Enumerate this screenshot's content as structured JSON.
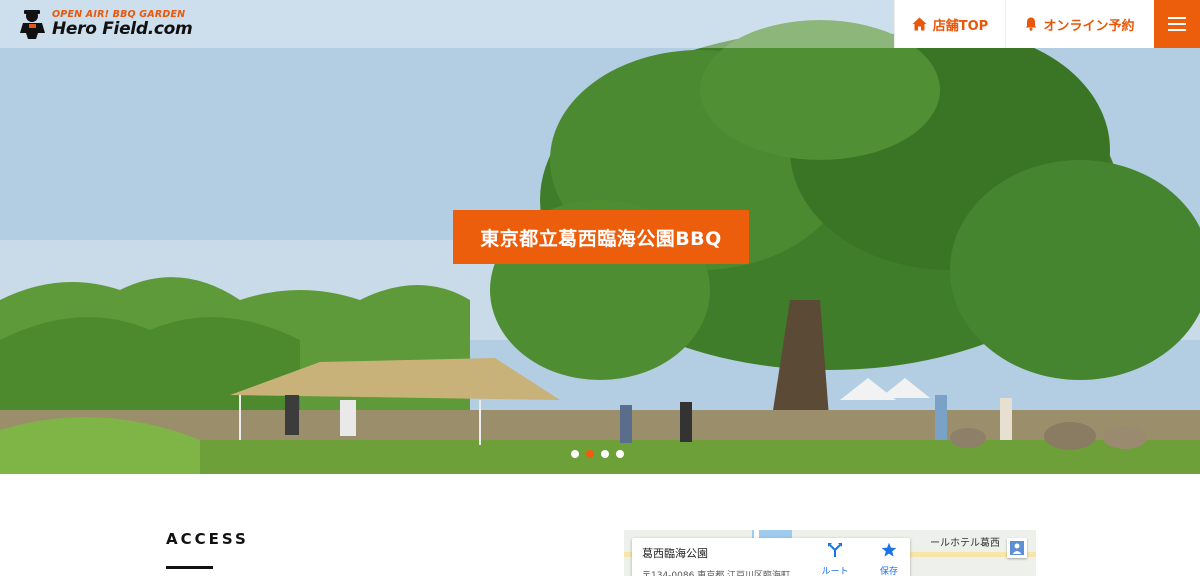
{
  "header": {
    "logo_tagline": "OPEN AIR! BBQ GARDEN",
    "logo_name": "Hero Field.com",
    "nav": {
      "store_top_label": "店舗TOP",
      "online_reserve_label": "オンライン予約"
    },
    "icons": {
      "store_top": "home-icon",
      "reserve": "bell-icon",
      "menu": "hamburger-menu-icon"
    }
  },
  "hero": {
    "title": "東京都立葛西臨海公園BBQ",
    "slides_total": 4,
    "active_slide": 2
  },
  "access": {
    "heading": "ACCESS"
  },
  "map": {
    "place_name": "葛西臨海公園",
    "address": "〒134-0086 東京都 江戸川区臨海町",
    "route_label": "ルート",
    "save_label": "保存",
    "nearby_label": "ールホテル葛西"
  },
  "colors": {
    "accent": "#ec5d0c",
    "header_text": "#e8570a"
  }
}
